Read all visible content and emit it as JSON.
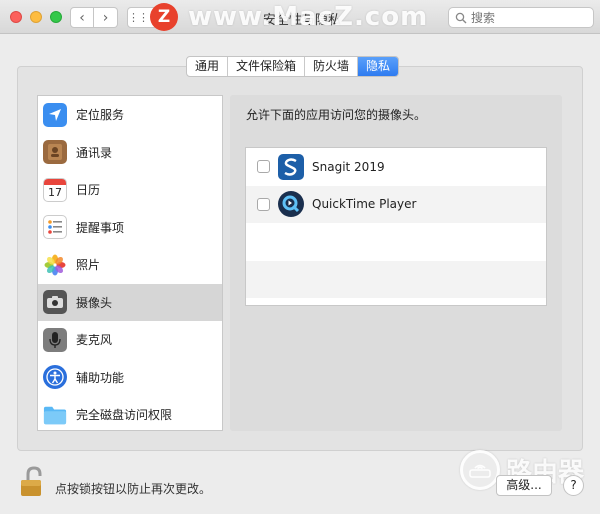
{
  "window": {
    "title": "安全性与隐私"
  },
  "watermark": {
    "logo": "Z",
    "text": "www.MacZ.com"
  },
  "search": {
    "placeholder": "搜索"
  },
  "tabs": [
    {
      "label": "通用"
    },
    {
      "label": "文件保险箱"
    },
    {
      "label": "防火墙"
    },
    {
      "label": "隐私",
      "active": true
    }
  ],
  "sidebar": {
    "items": [
      {
        "label": "定位服务",
        "icon": "location-icon",
        "color": "#3a8ef0"
      },
      {
        "label": "通讯录",
        "icon": "contacts-icon",
        "color": "#9b6a3f"
      },
      {
        "label": "日历",
        "icon": "calendar-icon",
        "color": "#ffffff",
        "day": "17"
      },
      {
        "label": "提醒事项",
        "icon": "reminders-icon",
        "color": "#ffffff"
      },
      {
        "label": "照片",
        "icon": "photos-icon",
        "color": "#ffffff"
      },
      {
        "label": "摄像头",
        "icon": "camera-icon",
        "color": "#555555",
        "selected": true
      },
      {
        "label": "麦克风",
        "icon": "microphone-icon",
        "color": "#7d7d7d"
      },
      {
        "label": "辅助功能",
        "icon": "accessibility-icon",
        "color": "#2a6fdc"
      },
      {
        "label": "完全磁盘访问权限",
        "icon": "folder-icon",
        "color": "#59b8f5"
      }
    ]
  },
  "main": {
    "prompt": "允许下面的应用访问您的摄像头。",
    "apps": [
      {
        "name": "Snagit 2019",
        "icon": "snagit-icon",
        "checked": false
      },
      {
        "name": "QuickTime Player",
        "icon": "quicktime-icon",
        "checked": false
      }
    ]
  },
  "footer": {
    "lock_text": "点按锁按钮以防止再次更改。",
    "advanced_label": "高级...",
    "help_label": "?"
  },
  "router_watermark": {
    "text": "路由器"
  }
}
